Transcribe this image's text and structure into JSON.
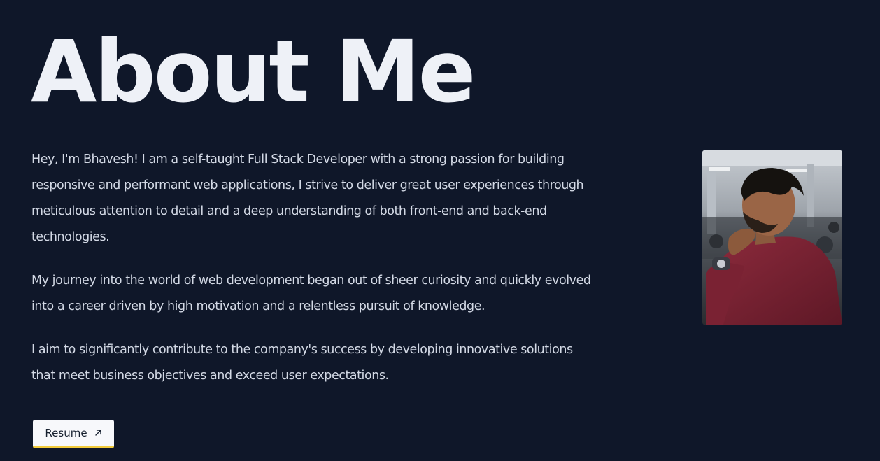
{
  "section": {
    "title": "About Me",
    "paragraphs": [
      "Hey, I'm Bhavesh! I am a self-taught Full Stack Developer with a strong passion for building responsive and performant web applications, I strive to deliver great user experiences through meticulous attention to detail and a deep understanding of both front-end and back-end technologies.",
      "My journey into the world of web development began out of sheer curiosity and quickly evolved into a career driven by high motivation and a relentless pursuit of knowledge.",
      "I aim to significantly contribute to the company's success by developing innovative solutions that meet business objectives and exceed user expectations."
    ],
    "resume_label": "Resume",
    "resume_icon": "arrow-up-right-icon"
  },
  "colors": {
    "background": "#0f1729",
    "title": "#eef1f7",
    "body_text": "#d3d9e5",
    "button_bg": "#f7f8fb",
    "button_accent": "#f2cb3b",
    "photo_jacket": "#7a2233"
  }
}
